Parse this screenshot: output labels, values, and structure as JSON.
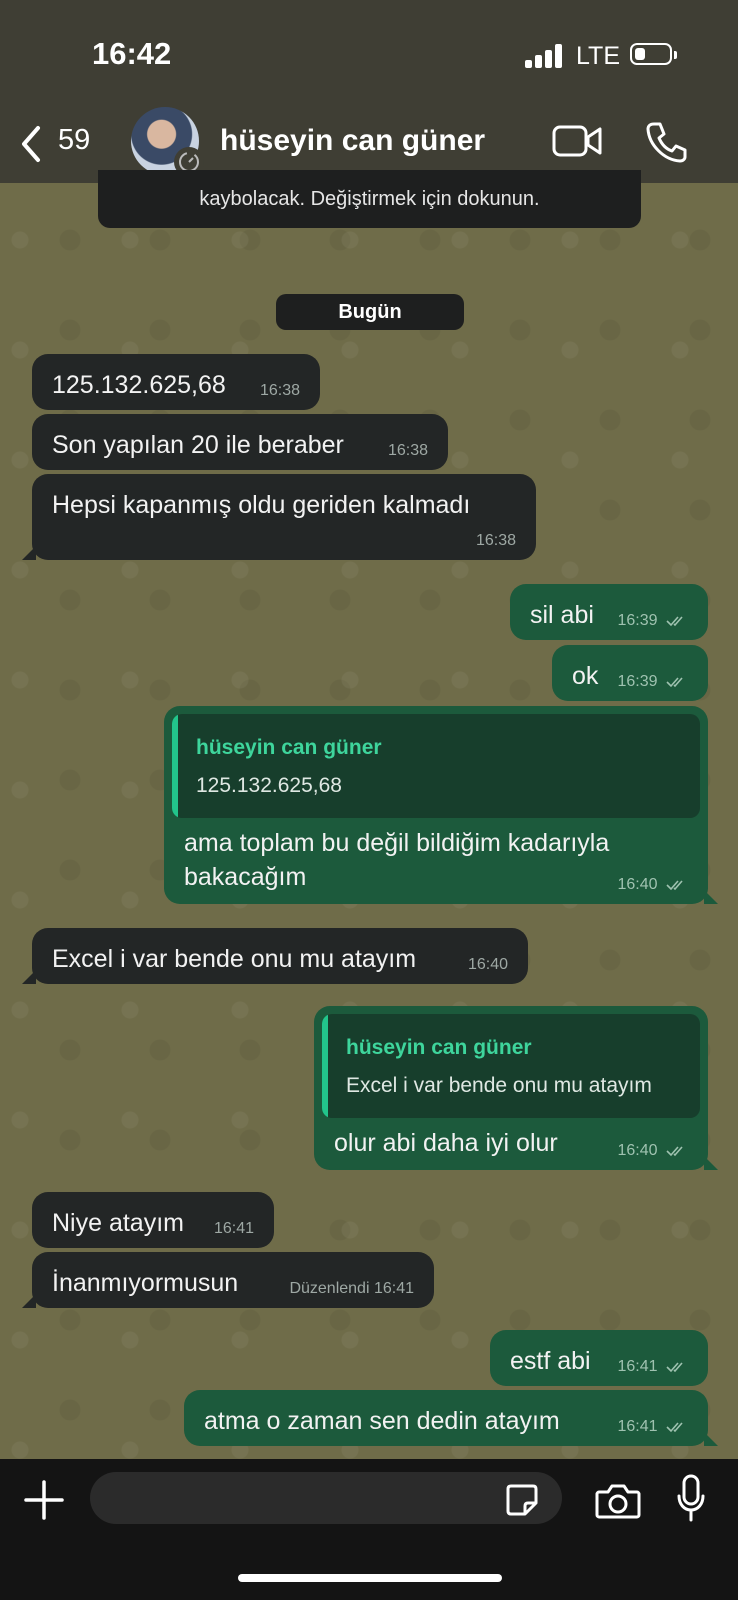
{
  "status": {
    "time": "16:42",
    "network": "LTE"
  },
  "header": {
    "back_count": "59",
    "contact_name": "hüseyin can güner"
  },
  "notice": {
    "text": "kaybolacak. Değiştirmek için dokunun."
  },
  "date_label": "Bugün",
  "messages": [
    {
      "dir": "in",
      "text": "125.132.625,68",
      "time": "16:38"
    },
    {
      "dir": "in",
      "text": "Son yapılan 20 ile beraber",
      "time": "16:38"
    },
    {
      "dir": "in",
      "text": "Hepsi kapanmış oldu geriden kalmadı",
      "time": "16:38"
    },
    {
      "dir": "out",
      "text": "sil abi",
      "time": "16:39"
    },
    {
      "dir": "out",
      "text": "ok",
      "time": "16:39"
    },
    {
      "dir": "out",
      "quote_name": "hüseyin can güner",
      "quote_text": "125.132.625,68",
      "text_line1": "ama toplam bu değil bildiğim kadarıyla",
      "text_line2": "bakacağım",
      "time": "16:40"
    },
    {
      "dir": "in",
      "text": "Excel i var bende onu mu atayım",
      "time": "16:40"
    },
    {
      "dir": "out",
      "quote_name": "hüseyin can güner",
      "quote_text": "Excel i var bende onu mu atayım",
      "text": "olur abi daha iyi olur",
      "time": "16:40"
    },
    {
      "dir": "in",
      "text": "Niye atayım",
      "time": "16:41"
    },
    {
      "dir": "in",
      "text": "İnanmıyormusun",
      "edited_label": "Düzenlendi",
      "time": "16:41"
    },
    {
      "dir": "out",
      "text": "estf abi",
      "time": "16:41"
    },
    {
      "dir": "out",
      "text": "atma o zaman sen dedin atayım",
      "time": "16:41"
    }
  ],
  "composer": {
    "placeholder": ""
  },
  "icons": {
    "back": "chevron-left-icon",
    "video": "video-camera-icon",
    "call": "phone-icon",
    "plus": "plus-icon",
    "sticker": "sticker-icon",
    "camera": "camera-icon",
    "mic": "microphone-icon"
  },
  "colors": {
    "incoming": "#232626",
    "outgoing": "#1c5a3c",
    "quote_accent": "#22c58b",
    "topbar": "#3f3e34"
  }
}
